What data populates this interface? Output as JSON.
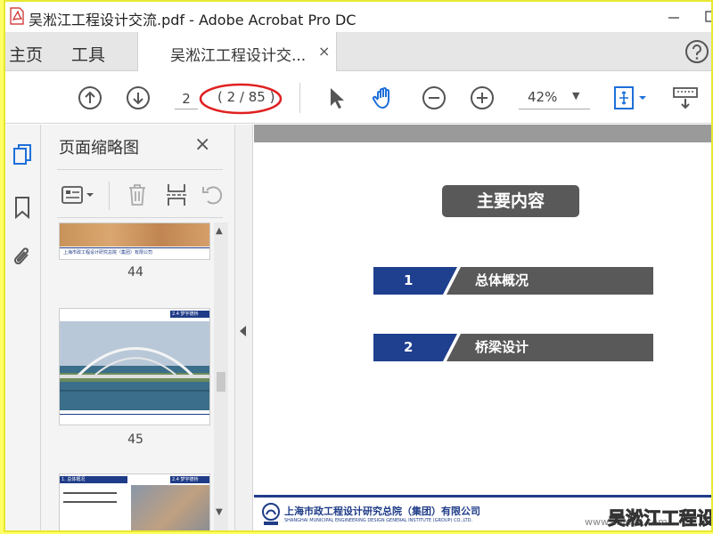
{
  "window": {
    "title": "吴淞江工程设计交流.pdf - Adobe Acrobat Pro DC"
  },
  "menu": {
    "home": "主页",
    "tools": "工具"
  },
  "doc_tab": {
    "label": "吴淞江工程设计交...",
    "close": "×"
  },
  "toolbar": {
    "page_value": "2",
    "page_count": "( 2 / 85 )",
    "zoom": "42%"
  },
  "thumbnails": {
    "title": "页面缩略图",
    "close": "×",
    "pages": [
      {
        "num": "44",
        "footer": "上海市政工程设计研究总院（集团）有限公司"
      },
      {
        "num": "45",
        "header": "2.4 梦宇德桥"
      },
      {
        "header_left": "1. 总体概况",
        "header_right": "2.4 梦宇德桥"
      }
    ]
  },
  "slide": {
    "title": "主要内容",
    "items": [
      {
        "num": "1",
        "label": "总体概况"
      },
      {
        "num": "2",
        "label": "桥梁设计"
      }
    ],
    "footer": "上海市政工程设计研究总院（集团）有限公司",
    "footer_sub": "SHANGHAI MUNICIPAL ENGINEERING DESIGN GENERAL INSTITUTE (GROUP) CO.,LTD."
  },
  "watermark": {
    "text": "吴淞江工程设",
    "url": "www.cnjdao.com"
  },
  "colors": {
    "accent_blue": "#1f3f8f",
    "dark_gray": "#595959",
    "annotation_red": "#e02020"
  }
}
